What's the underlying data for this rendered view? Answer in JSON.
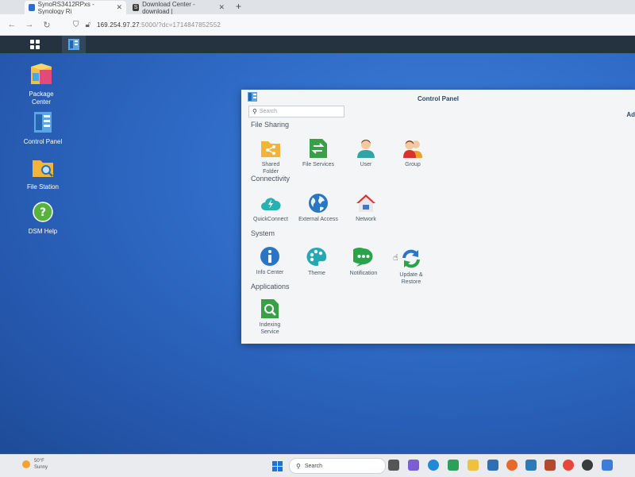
{
  "browser": {
    "tabs": [
      {
        "title": "SynoRS3412RPxs - Synology Ri",
        "close": "✕",
        "favicon_color": "#2c6fd1"
      },
      {
        "title": "Download Center - download |",
        "close": "✕",
        "favicon_color": "#3a3a3a",
        "favicon_letter": "S"
      }
    ],
    "new_tab": "+",
    "url_host": "169.254.97.27",
    "url_rest": ":5000/?dc=1714847852552"
  },
  "desktop": {
    "icons": [
      {
        "label_line1": "Package",
        "label_line2": "Center"
      },
      {
        "label_line1": "Control Panel",
        "label_line2": ""
      },
      {
        "label_line1": "File Station",
        "label_line2": ""
      },
      {
        "label_line1": "DSM Help",
        "label_line2": ""
      }
    ]
  },
  "control_panel": {
    "title": "Control Panel",
    "right_clip": "Ad",
    "search_placeholder": "Search",
    "sections": {
      "file_sharing": "File Sharing",
      "connectivity": "Connectivity",
      "system": "System",
      "applications": "Applications"
    },
    "items": {
      "shared_folder": {
        "l1": "Shared",
        "l2": "Folder"
      },
      "file_services": {
        "l1": "File Services",
        "l2": ""
      },
      "user": {
        "l1": "User",
        "l2": ""
      },
      "group": {
        "l1": "Group",
        "l2": ""
      },
      "quickconnect": {
        "l1": "QuickConnect",
        "l2": ""
      },
      "external_access": {
        "l1": "External Access",
        "l2": ""
      },
      "network": {
        "l1": "Network",
        "l2": ""
      },
      "info_center": {
        "l1": "Info Center",
        "l2": ""
      },
      "theme": {
        "l1": "Theme",
        "l2": ""
      },
      "notification": {
        "l1": "Notification",
        "l2": ""
      },
      "update_restore": {
        "l1": "Update &",
        "l2": "Restore"
      },
      "indexing_service": {
        "l1": "Indexing",
        "l2": "Service"
      }
    }
  },
  "taskbar": {
    "weather_temp": "50°F",
    "weather_desc": "Sunny",
    "search_label": "Search"
  },
  "colors": {
    "dsm_bar": "#253240",
    "desktop_blue": "#2f6bc7",
    "accent_green": "#3aa047",
    "accent_teal": "#2ab0b0"
  }
}
